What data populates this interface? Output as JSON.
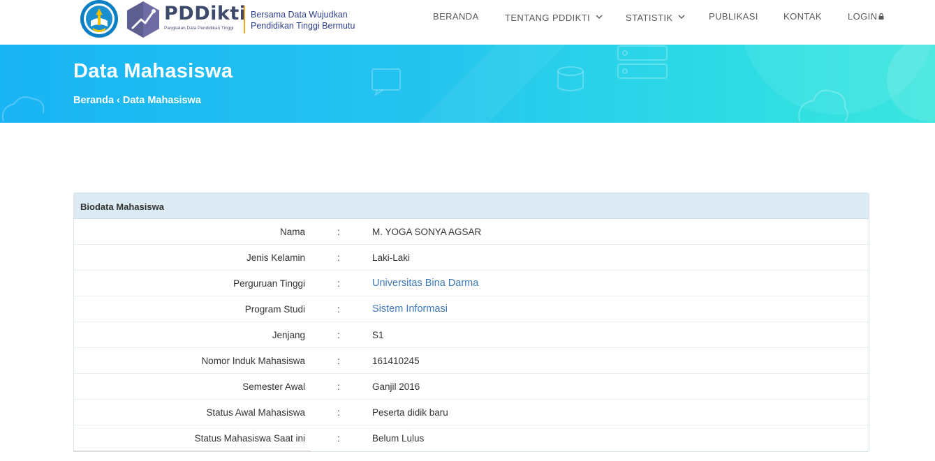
{
  "brand": {
    "name": "PDDikti",
    "subtitle": "Pangkalan Data Pendidikan Tinggi",
    "tagline_line1": "Bersama Data Wujudkan",
    "tagline_line2": "Pendidikan Tinggi Bermutu"
  },
  "nav": {
    "items": [
      {
        "label": "BERANDA"
      },
      {
        "label": "TENTANG PDDIKTI"
      },
      {
        "label": "STATISTIK"
      },
      {
        "label": "PUBLIKASI"
      },
      {
        "label": "KONTAK"
      },
      {
        "label": "LOGIN"
      }
    ]
  },
  "hero": {
    "title": "Data Mahasiswa",
    "breadcrumb_home": "Beranda",
    "breadcrumb_separator": "‹",
    "breadcrumb_current": "Data Mahasiswa"
  },
  "panel": {
    "heading": "Biodata Mahasiswa",
    "colon": ":",
    "rows": [
      {
        "label": "Nama",
        "value": "M. YOGA SONYA AGSAR"
      },
      {
        "label": "Jenis Kelamin",
        "value": "Laki-Laki"
      },
      {
        "label": "Perguruan Tinggi",
        "value": "Universitas Bina Darma"
      },
      {
        "label": "Program Studi",
        "value": "Sistem Informasi"
      },
      {
        "label": "Jenjang",
        "value": "S1"
      },
      {
        "label": "Nomor Induk Mahasiswa",
        "value": "161410245"
      },
      {
        "label": "Semester Awal",
        "value": "Ganjil 2016"
      },
      {
        "label": "Status Awal Mahasiswa",
        "value": "Peserta didik baru"
      },
      {
        "label": "Status Mahasiswa Saat ini",
        "value": "Belum Lulus"
      }
    ]
  },
  "colors": {
    "hero_start": "#19b4f4",
    "hero_end": "#3ae5de",
    "link": "#3c79b8",
    "brand_text": "#3d4a6b",
    "tagline": "#2d3d8a",
    "accent_divider": "#f5a623",
    "panel_heading_bg": "#dcebf4"
  }
}
